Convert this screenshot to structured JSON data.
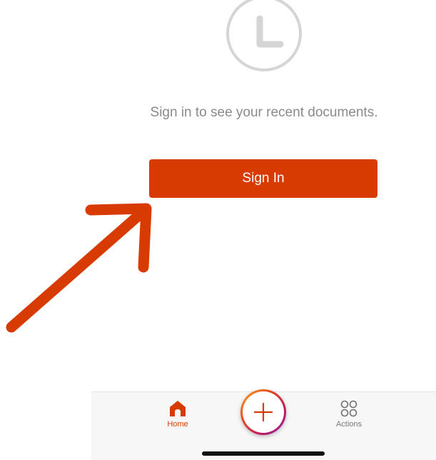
{
  "main": {
    "icon": "clock-icon",
    "message": "Sign in to see your recent documents.",
    "sign_in_label": "Sign In",
    "accent_color": "#d83b01"
  },
  "annotation": {
    "icon": "arrow-icon",
    "color": "#d83b01"
  },
  "tab_bar": {
    "tabs": [
      {
        "label": "Home",
        "icon": "home-icon",
        "selected": true
      },
      {
        "label": "Actions",
        "icon": "actions-icon",
        "selected": false
      }
    ],
    "create_icon": "plus-icon"
  }
}
